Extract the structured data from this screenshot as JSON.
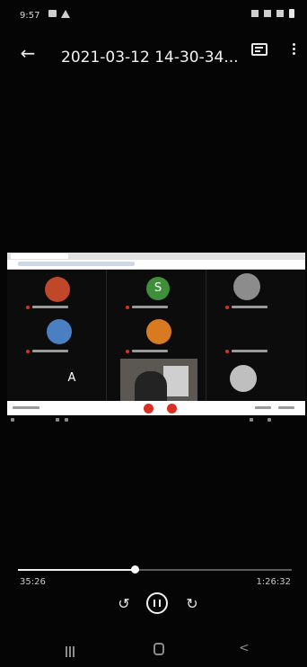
{
  "status_bar": {
    "time": "9:57"
  },
  "header": {
    "back_icon": "arrow-left-icon",
    "title": "2021-03-12 14-30-34...",
    "caption_icon": "subtitles-icon",
    "more_icon": "more-vert-icon"
  },
  "video": {
    "content": "recorded video-meeting grid",
    "tiles": [
      {
        "type": "photo-avatar",
        "color": "#c0472a"
      },
      {
        "type": "letter-avatar",
        "letter": "S",
        "color": "#3f8f3a"
      },
      {
        "type": "photo-avatar",
        "color": "#8c8c8c"
      },
      {
        "type": "photo-avatar",
        "color": "#4a7fc1"
      },
      {
        "type": "photo-avatar",
        "color": "#d77a20"
      },
      {
        "type": "photo-avatar",
        "color": "#1a1a1a"
      },
      {
        "type": "letter-avatar",
        "letter": "A",
        "color": "#0c0c0c"
      },
      {
        "type": "camera",
        "color": "#5b5854"
      },
      {
        "type": "photo-avatar",
        "color": "#bfbfbf"
      }
    ],
    "controls_colors": {
      "end_call": "#d93025"
    }
  },
  "player": {
    "elapsed": "35:26",
    "total": "1:26:32",
    "progress": 0.425,
    "rewind_icon": "replay-10-icon",
    "pause_icon": "pause-icon",
    "forward_icon": "forward-10-icon"
  },
  "nav_bar": {
    "recents_icon": "recents-icon",
    "home_icon": "home-icon",
    "back_icon": "back-chevron-icon"
  },
  "colors": {
    "background": "#050505",
    "text": "#f2f2f2",
    "progress": "#f0f0f0"
  }
}
